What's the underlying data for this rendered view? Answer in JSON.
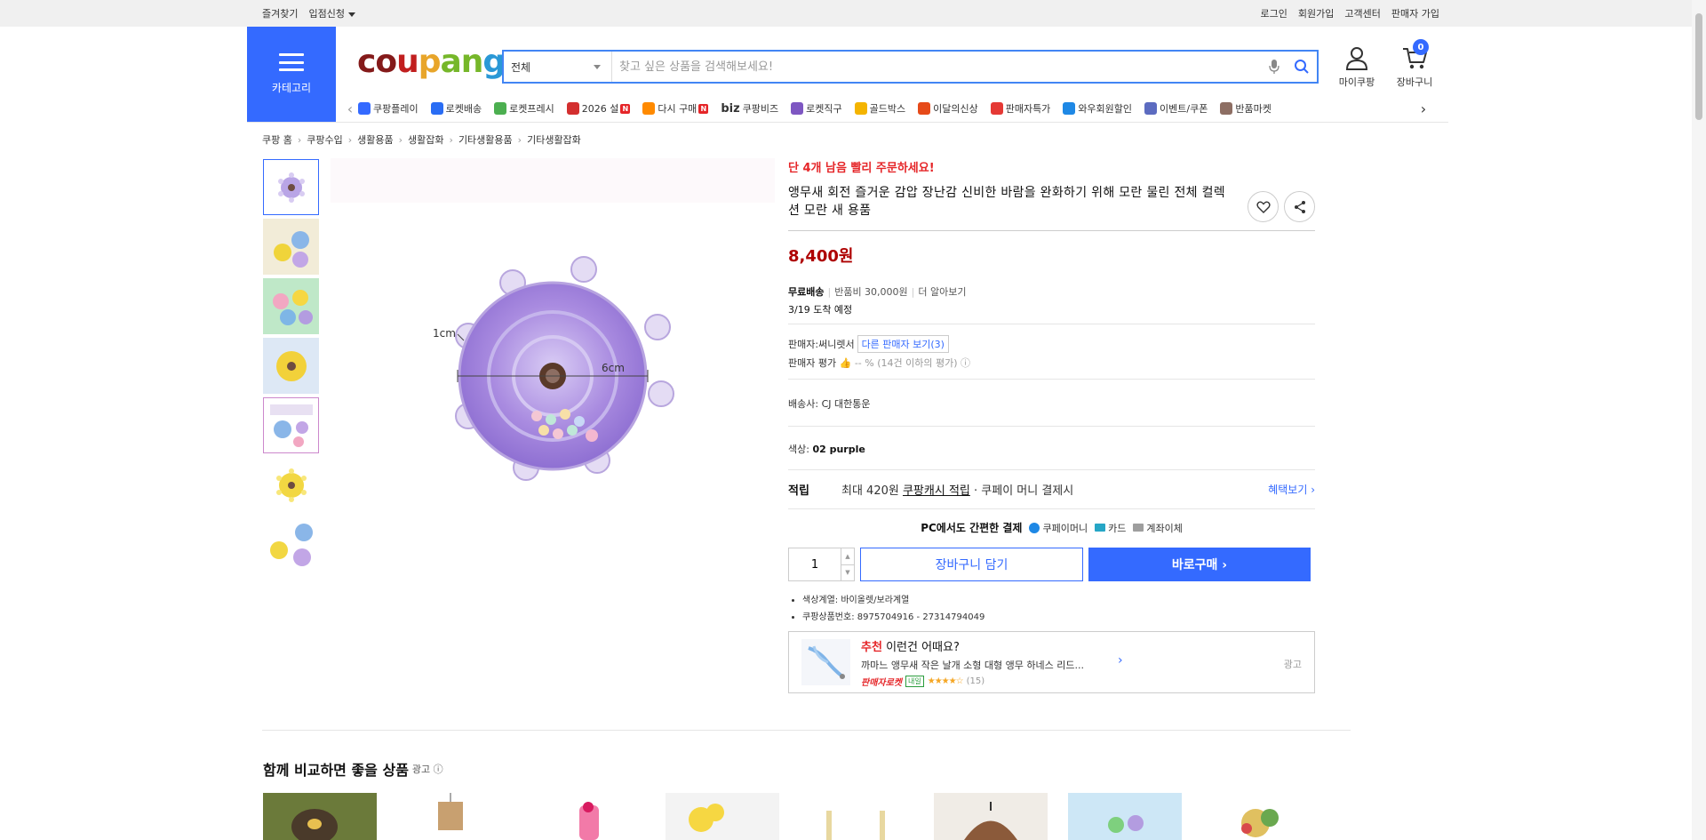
{
  "topbar": {
    "left": [
      "즐겨찾기",
      "입점신청"
    ],
    "right": [
      "로그인",
      "회원가입",
      "고객센터",
      "판매자 가입"
    ]
  },
  "header": {
    "category_label": "카테고리",
    "logo": [
      "co",
      "u",
      "p",
      "an",
      "g"
    ],
    "search_select": "전체",
    "search_placeholder": "찾고 싶은 상품을 검색해보세요!",
    "mycoupang": "마이쿠팡",
    "cart": "장바구니",
    "cart_count": "0"
  },
  "shortcuts": [
    {
      "label": "쿠팡플레이",
      "color": "#346aff",
      "new": false
    },
    {
      "label": "로켓배송",
      "color": "#2a6df4",
      "new": false
    },
    {
      "label": "로켓프레시",
      "color": "#4caf50",
      "new": false
    },
    {
      "label": "2026 설",
      "color": "#d32f2f",
      "new": true
    },
    {
      "label": "다시 구매",
      "color": "#ff8a00",
      "new": true
    },
    {
      "label": "쿠팡비즈",
      "color": "#333333",
      "new": false,
      "prefix": "biz"
    },
    {
      "label": "로켓직구",
      "color": "#7e57c2",
      "new": false
    },
    {
      "label": "골드박스",
      "color": "#f4b400",
      "new": false
    },
    {
      "label": "이달의신상",
      "color": "#e64a19",
      "new": false
    },
    {
      "label": "판매자특가",
      "color": "#e53935",
      "new": false
    },
    {
      "label": "와우회원할인",
      "color": "#1e88e5",
      "new": false
    },
    {
      "label": "이벤트/쿠폰",
      "color": "#5c6bc0",
      "new": false
    },
    {
      "label": "반품마켓",
      "color": "#8d6e63",
      "new": false
    }
  ],
  "breadcrumb": [
    "쿠팡 홈",
    "쿠팡수입",
    "생활용품",
    "생활잡화",
    "기타생활용품",
    "기타생활잡화"
  ],
  "image_labels": {
    "d1": "1cm",
    "d2": "6cm"
  },
  "product": {
    "urgent": "단 4개 남음 빨리 주문하세요!",
    "title": "앵무새 회전 즐거운 감압 장난감 신비한 바람을 완화하기 위해 모란 물린 전체 컬렉션 모란 새 용품",
    "price": "8,400원",
    "ship_free": "무료배송",
    "ship_return": "반품비 30,000원",
    "ship_more": "더 알아보기",
    "eta": "3/19 도착 예정",
    "seller_label": "판매자:",
    "seller_name": "써니렛서",
    "other_sellers": "다른 판매자 보기(3)",
    "seller_rating_label": "판매자 평가",
    "seller_rating_value": "-- % (14건 이하의 평가)",
    "carrier_label": "배송사:",
    "carrier": "CJ 대한통운",
    "color_label": "색상:",
    "color": "02 purple",
    "reward_label": "적립",
    "reward_text1": "최대 420원",
    "reward_link": "쿠팡캐시 적립",
    "reward_text2": "· 쿠페이 머니 결제시",
    "reward_more": "혜택보기 ›",
    "pay_label": "PC에서도 간편한 결제",
    "pay_methods": [
      "쿠페이머니",
      "카드",
      "계좌이체"
    ],
    "qty": "1",
    "cart_btn": "장바구니 담기",
    "buy_btn": "바로구매 ›",
    "attrs": [
      "색상계열: 바이올렛/보라계열",
      "쿠팡상품번호: 8975704916 - 27314794049"
    ]
  },
  "reco": {
    "tag": "추천",
    "title": "이런건 어때요?",
    "name": "까마느 앵무새 작은 날개 소형 대형 앵무 하네스 리드...",
    "badge1": "판매자로켓",
    "badge2": "내일",
    "stars": "★★★★☆",
    "count": "(15)",
    "ad": "광고"
  },
  "compare": {
    "title": "함께 비교하면 좋을 상품",
    "ad": "광고 ⓘ"
  }
}
